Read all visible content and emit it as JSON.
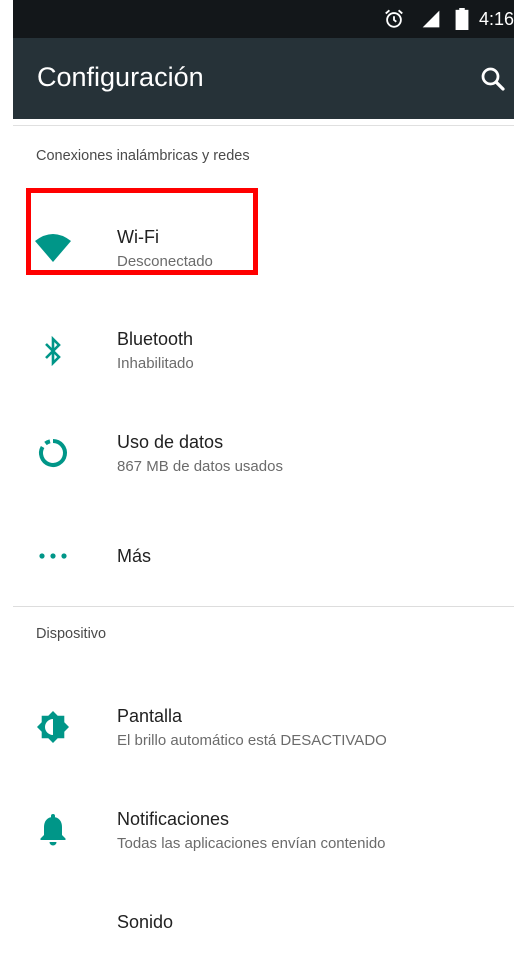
{
  "status_bar": {
    "time": "4:16",
    "icons": [
      "alarm-icon",
      "signal-icon",
      "battery-icon"
    ]
  },
  "app_bar": {
    "title": "Configuración",
    "search_icon": "search-icon"
  },
  "sections": {
    "wireless": {
      "header": "Conexiones inalámbricas y redes",
      "wifi": {
        "title": "Wi-Fi",
        "summary": "Desconectado",
        "icon": "wifi-icon"
      },
      "bluetooth": {
        "title": "Bluetooth",
        "summary": "Inhabilitado",
        "icon": "bluetooth-icon"
      },
      "data_usage": {
        "title": "Uso de datos",
        "summary": "867 MB de datos usados",
        "icon": "data-usage-icon"
      },
      "more": {
        "title": "Más",
        "icon": "more-dots-icon"
      }
    },
    "device": {
      "header": "Dispositivo",
      "display": {
        "title": "Pantalla",
        "summary": "El brillo automático está DESACTIVADO",
        "icon": "brightness-icon"
      },
      "notifications": {
        "title": "Notificaciones",
        "summary": "Todas las aplicaciones envían contenido",
        "icon": "bell-icon"
      },
      "sound": {
        "title": "Sonido",
        "icon": "sound-icon"
      }
    }
  },
  "colors": {
    "accent": "#009688",
    "app_bar": "#263238",
    "status_bar": "#13171a",
    "highlight": "#ff0000"
  }
}
